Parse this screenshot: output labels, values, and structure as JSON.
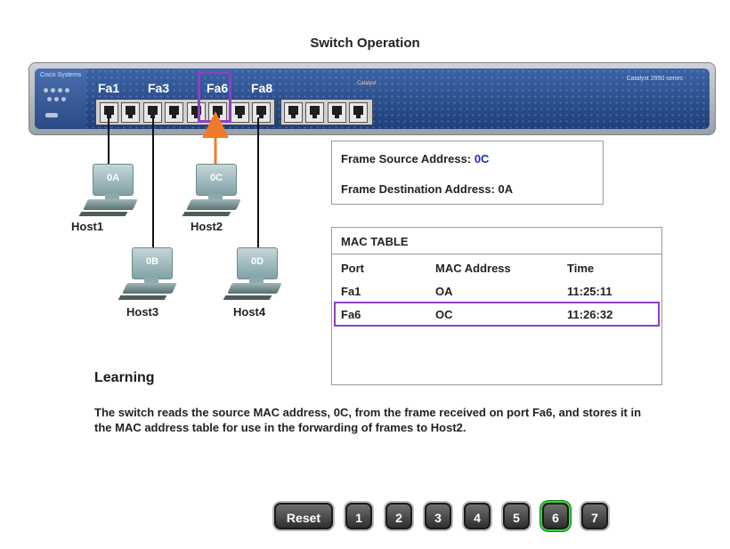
{
  "title": "Switch Operation",
  "switch": {
    "brand": "Cisco Systems",
    "model": "Catalyst 2950 series",
    "ports": [
      "Fa1",
      "Fa3",
      "Fa6",
      "Fa8"
    ]
  },
  "hosts": [
    {
      "name": "Host1",
      "mac": "0A"
    },
    {
      "name": "Host2",
      "mac": "0C"
    },
    {
      "name": "Host3",
      "mac": "0B"
    },
    {
      "name": "Host4",
      "mac": "0D"
    }
  ],
  "frame": {
    "source_label": "Frame Source Address:",
    "source_value": "0C",
    "dest_label": "Frame Destination Address: 0A"
  },
  "mac_table": {
    "title": "MAC TABLE",
    "headers": [
      "Port",
      "MAC Address",
      "Time"
    ],
    "rows": [
      [
        "Fa1",
        "OA",
        "11:25:11"
      ],
      [
        "Fa6",
        "OC",
        "11:26:32"
      ]
    ]
  },
  "step_title": "Learning",
  "description": "The switch reads the source MAC address, 0C, from the frame received on port Fa6, and stores it in the MAC address table for use in the forwarding of frames to Host2.",
  "nav": {
    "reset": "Reset",
    "steps": [
      "1",
      "2",
      "3",
      "4",
      "5",
      "6",
      "7"
    ],
    "active_step": "6"
  },
  "colors": {
    "highlight": "#8e3fc4",
    "arrow": "#f07a2a",
    "blue_text": "#1c2fb8",
    "active_button": "#39d33c"
  }
}
